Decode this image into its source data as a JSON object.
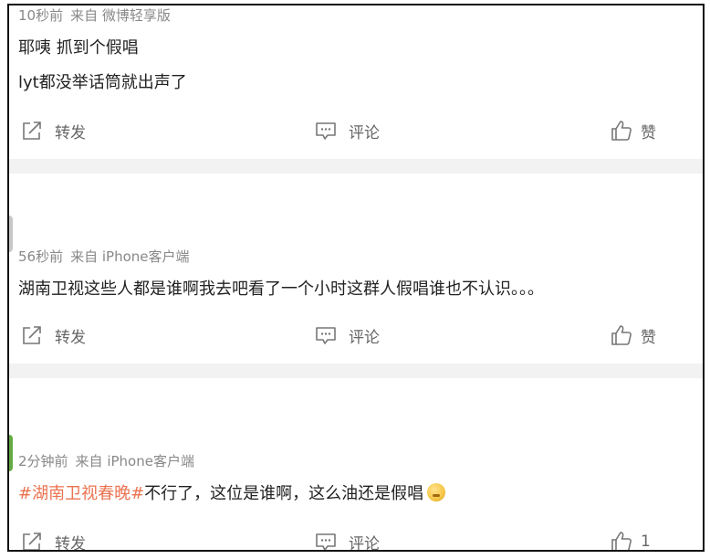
{
  "colors": {
    "text": "#222222",
    "meta": "#888888",
    "action": "#666666",
    "hashtag": "#eb7350",
    "separator": "#f2f2f2"
  },
  "icons": {
    "share": "share-icon",
    "comment": "comment-icon",
    "like": "thumbs-up-icon",
    "emoji": "shushing-face-emoji"
  },
  "posts": [
    {
      "time": "10秒前",
      "source": "来自 微博轻享版",
      "lines": [
        "耶咦 抓到个假唱",
        "lyt都没举话筒就出声了"
      ],
      "actions": {
        "share": "转发",
        "comment": "评论",
        "like": "赞"
      }
    },
    {
      "time": "56秒前",
      "source": "来自 iPhone客户端",
      "lines": [
        "湖南卫视这些人都是谁啊我去吧看了一个小时这群人假唱谁也不认识。。。"
      ],
      "actions": {
        "share": "转发",
        "comment": "评论",
        "like": "赞"
      }
    },
    {
      "time": "2分钟前",
      "source": "来自 iPhone客户端",
      "hashtag": "#湖南卫视春晚#",
      "text_after_hashtag": "不行了，这位是谁啊，这么油还是假唱",
      "actions": {
        "share": "转发",
        "comment": "评论",
        "like": "1"
      }
    }
  ]
}
